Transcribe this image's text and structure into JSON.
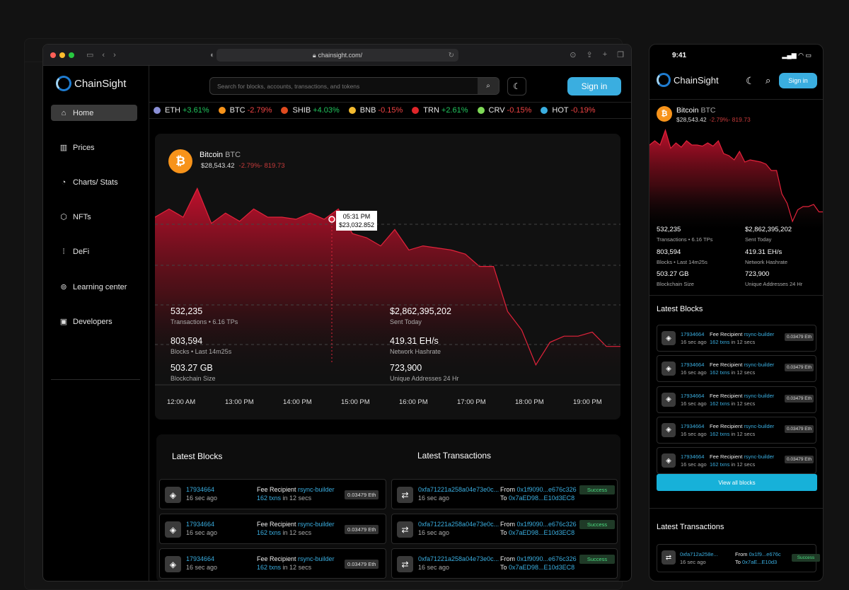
{
  "browser": {
    "url": "chainsight.com/"
  },
  "brand": {
    "name": "ChainSight"
  },
  "sidebar": {
    "items": [
      {
        "label": "Home",
        "icon": "home-icon"
      },
      {
        "label": "Prices",
        "icon": "bar-chart-icon"
      },
      {
        "label": "Charts/ Stats",
        "icon": "pie-chart-icon"
      },
      {
        "label": "NFTs",
        "icon": "nft-icon"
      },
      {
        "label": "DeFi",
        "icon": "defi-icon"
      },
      {
        "label": "Learning center",
        "icon": "location-pin-icon"
      },
      {
        "label": "Developers",
        "icon": "code-icon"
      }
    ]
  },
  "header": {
    "search_placeholder": "Search for blocks, accounts, transactions, and tokens",
    "signin_label": "Sign in"
  },
  "ticker": [
    {
      "symbol": "ETH",
      "change": "+3.61%",
      "dir": "up",
      "color": "#8a8fd6"
    },
    {
      "symbol": "BTC",
      "change": "-2.79%",
      "dir": "down",
      "color": "#f7931a"
    },
    {
      "symbol": "SHIB",
      "change": "+4.03%",
      "dir": "up",
      "color": "#e04b1f"
    },
    {
      "symbol": "BNB",
      "change": "-0.15%",
      "dir": "down",
      "color": "#f3ba2f"
    },
    {
      "symbol": "TRN",
      "change": "+2.61%",
      "dir": "up",
      "color": "#e0262a"
    },
    {
      "symbol": "CRV",
      "change": "-0.15%",
      "dir": "down",
      "color": "#7ed957"
    },
    {
      "symbol": "HOT",
      "change": "-0.19%",
      "dir": "down",
      "color": "#3aaee0"
    }
  ],
  "coin": {
    "name": "Bitcoin",
    "ticker": "BTC",
    "price": "$28,543.42",
    "change": "-2.79%- 819.73"
  },
  "tooltip": {
    "time": "05:31 PM",
    "price": "$23,032.852"
  },
  "stats": [
    {
      "value": "532,235",
      "label": "Transactions • 6.16 TPs"
    },
    {
      "value": "$2,862,395,202",
      "label": "Sent Today"
    },
    {
      "value": "803,594",
      "label": "Blocks • Last 14m25s"
    },
    {
      "value": "419.31 EH/s",
      "label": "Network Hashrate"
    },
    {
      "value": "503.27 GB",
      "label": "Blockchain Size"
    },
    {
      "value": "723,900",
      "label": "Unique Addresses 24 Hr"
    }
  ],
  "phone_stats": [
    {
      "value": "532,235",
      "label": "Transactions • 6.16 TPs"
    },
    {
      "value": "$2,862,395,202",
      "label": "Sent Today"
    },
    {
      "value": "803,594",
      "label": "Blocks • Last 14m25s"
    },
    {
      "value": "419.31 EH/s",
      "label": "Network Hashrate"
    },
    {
      "value": "503.27 GB",
      "label": "Blockchain Size"
    },
    {
      "value": "723,900",
      "label": "Unique Addresses 24 Hr"
    }
  ],
  "chart_data": {
    "type": "area",
    "x_labels": [
      "12:00 AM",
      "13:00 PM",
      "14:00 PM",
      "15:00 PM",
      "16:00 PM",
      "17:00 PM",
      "18:00 PM",
      "19:00 PM"
    ],
    "series_color": "#c8102e",
    "points": [
      0.8,
      0.84,
      0.8,
      0.94,
      0.77,
      0.82,
      0.78,
      0.84,
      0.8,
      0.8,
      0.79,
      0.82,
      0.79,
      0.84,
      0.72,
      0.7,
      0.66,
      0.74,
      0.64,
      0.66,
      0.65,
      0.64,
      0.62,
      0.56,
      0.56,
      0.34,
      0.25,
      0.08,
      0.19,
      0.22,
      0.22,
      0.24,
      0.17,
      0.17
    ]
  },
  "latest_blocks": {
    "title": "Latest Blocks",
    "rows": [
      {
        "block": "17934664",
        "age": "16 sec ago",
        "fee_label": "Fee Recipient",
        "recipient": "rsync-builder",
        "txns": "162 txns",
        "txns_suffix": "in 12 secs",
        "amount": "0.03479 Eth"
      },
      {
        "block": "17934664",
        "age": "16 sec ago",
        "fee_label": "Fee Recipient",
        "recipient": "rsync-builder",
        "txns": "162 txns",
        "txns_suffix": "in 12 secs",
        "amount": "0.03479 Eth"
      },
      {
        "block": "17934664",
        "age": "16 sec ago",
        "fee_label": "Fee Recipient",
        "recipient": "rsync-builder",
        "txns": "162 txns",
        "txns_suffix": "in 12 secs",
        "amount": "0.03479 Eth"
      }
    ]
  },
  "latest_transactions": {
    "title": "Latest Transactions",
    "rows": [
      {
        "hash": "0xfa71221a258a04e73e0c...",
        "age": "16 sec ago",
        "from_label": "From",
        "from": "0x1f9090...e676c326",
        "to_label": "To",
        "to": "0x7aED98...E10d3EC8",
        "status": "Success"
      },
      {
        "hash": "0xfa71221a258a04e73e0c...",
        "age": "16 sec ago",
        "from_label": "From",
        "from": "0x1f9090...e676c326",
        "to_label": "To",
        "to": "0x7aED98...E10d3EC8",
        "status": "Success"
      },
      {
        "hash": "0xfa71221a258a04e73e0c...",
        "age": "16 sec ago",
        "from_label": "From",
        "from": "0x1f9090...e676c326",
        "to_label": "To",
        "to": "0x7aED98...E10d3EC8",
        "status": "Success"
      }
    ]
  },
  "phone": {
    "time": "9:41",
    "signin_label": "Sign in",
    "latest_blocks_title": "Latest Blocks",
    "view_all": "View all blocks",
    "latest_tx_title": "Latest Transactions",
    "blocks": [
      {
        "block": "17934664",
        "age": "16 sec ago",
        "fee_label": "Fee Recipient",
        "recipient": "rsync-builder",
        "txns": "162 txns",
        "txns_suffix": "in 12 secs",
        "amount": "0.03479 Eth"
      },
      {
        "block": "17934664",
        "age": "16 sec ago",
        "fee_label": "Fee Recipient",
        "recipient": "rsync-builder",
        "txns": "162 txns",
        "txns_suffix": "in 12 secs",
        "amount": "0.03479 Eth"
      },
      {
        "block": "17934664",
        "age": "16 sec ago",
        "fee_label": "Fee Recipient",
        "recipient": "rsync-builder",
        "txns": "162 txns",
        "txns_suffix": "in 12 secs",
        "amount": "0.03479 Eth"
      },
      {
        "block": "17934664",
        "age": "16 sec ago",
        "fee_label": "Fee Recipient",
        "recipient": "rsync-builder",
        "txns": "162 txns",
        "txns_suffix": "in 12 secs",
        "amount": "0.03479 Eth"
      },
      {
        "block": "17934664",
        "age": "16 sec ago",
        "fee_label": "Fee Recipient",
        "recipient": "rsync-builder",
        "txns": "162 txns",
        "txns_suffix": "in 12 secs",
        "amount": "0.03479 Eth"
      }
    ],
    "tx": {
      "hash": "0xfa712a258e...",
      "age": "16 sec ago",
      "from_label": "From",
      "from": "0x1f9...e676c",
      "to_label": "To",
      "to": "0x7aE...E10d3",
      "status": "Success"
    }
  }
}
